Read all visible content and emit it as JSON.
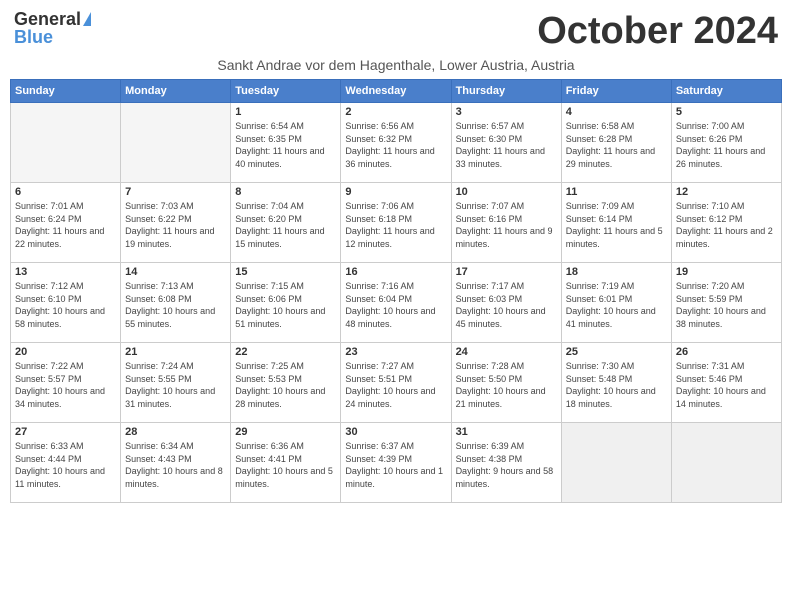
{
  "header": {
    "logo_general": "General",
    "logo_blue": "Blue",
    "month_year": "October 2024",
    "subtitle": "Sankt Andrae vor dem Hagenthale, Lower Austria, Austria"
  },
  "weekdays": [
    "Sunday",
    "Monday",
    "Tuesday",
    "Wednesday",
    "Thursday",
    "Friday",
    "Saturday"
  ],
  "weeks": [
    [
      {
        "day": "",
        "info": ""
      },
      {
        "day": "",
        "info": ""
      },
      {
        "day": "1",
        "info": "Sunrise: 6:54 AM\nSunset: 6:35 PM\nDaylight: 11 hours and 40 minutes."
      },
      {
        "day": "2",
        "info": "Sunrise: 6:56 AM\nSunset: 6:32 PM\nDaylight: 11 hours and 36 minutes."
      },
      {
        "day": "3",
        "info": "Sunrise: 6:57 AM\nSunset: 6:30 PM\nDaylight: 11 hours and 33 minutes."
      },
      {
        "day": "4",
        "info": "Sunrise: 6:58 AM\nSunset: 6:28 PM\nDaylight: 11 hours and 29 minutes."
      },
      {
        "day": "5",
        "info": "Sunrise: 7:00 AM\nSunset: 6:26 PM\nDaylight: 11 hours and 26 minutes."
      }
    ],
    [
      {
        "day": "6",
        "info": "Sunrise: 7:01 AM\nSunset: 6:24 PM\nDaylight: 11 hours and 22 minutes."
      },
      {
        "day": "7",
        "info": "Sunrise: 7:03 AM\nSunset: 6:22 PM\nDaylight: 11 hours and 19 minutes."
      },
      {
        "day": "8",
        "info": "Sunrise: 7:04 AM\nSunset: 6:20 PM\nDaylight: 11 hours and 15 minutes."
      },
      {
        "day": "9",
        "info": "Sunrise: 7:06 AM\nSunset: 6:18 PM\nDaylight: 11 hours and 12 minutes."
      },
      {
        "day": "10",
        "info": "Sunrise: 7:07 AM\nSunset: 6:16 PM\nDaylight: 11 hours and 9 minutes."
      },
      {
        "day": "11",
        "info": "Sunrise: 7:09 AM\nSunset: 6:14 PM\nDaylight: 11 hours and 5 minutes."
      },
      {
        "day": "12",
        "info": "Sunrise: 7:10 AM\nSunset: 6:12 PM\nDaylight: 11 hours and 2 minutes."
      }
    ],
    [
      {
        "day": "13",
        "info": "Sunrise: 7:12 AM\nSunset: 6:10 PM\nDaylight: 10 hours and 58 minutes."
      },
      {
        "day": "14",
        "info": "Sunrise: 7:13 AM\nSunset: 6:08 PM\nDaylight: 10 hours and 55 minutes."
      },
      {
        "day": "15",
        "info": "Sunrise: 7:15 AM\nSunset: 6:06 PM\nDaylight: 10 hours and 51 minutes."
      },
      {
        "day": "16",
        "info": "Sunrise: 7:16 AM\nSunset: 6:04 PM\nDaylight: 10 hours and 48 minutes."
      },
      {
        "day": "17",
        "info": "Sunrise: 7:17 AM\nSunset: 6:03 PM\nDaylight: 10 hours and 45 minutes."
      },
      {
        "day": "18",
        "info": "Sunrise: 7:19 AM\nSunset: 6:01 PM\nDaylight: 10 hours and 41 minutes."
      },
      {
        "day": "19",
        "info": "Sunrise: 7:20 AM\nSunset: 5:59 PM\nDaylight: 10 hours and 38 minutes."
      }
    ],
    [
      {
        "day": "20",
        "info": "Sunrise: 7:22 AM\nSunset: 5:57 PM\nDaylight: 10 hours and 34 minutes."
      },
      {
        "day": "21",
        "info": "Sunrise: 7:24 AM\nSunset: 5:55 PM\nDaylight: 10 hours and 31 minutes."
      },
      {
        "day": "22",
        "info": "Sunrise: 7:25 AM\nSunset: 5:53 PM\nDaylight: 10 hours and 28 minutes."
      },
      {
        "day": "23",
        "info": "Sunrise: 7:27 AM\nSunset: 5:51 PM\nDaylight: 10 hours and 24 minutes."
      },
      {
        "day": "24",
        "info": "Sunrise: 7:28 AM\nSunset: 5:50 PM\nDaylight: 10 hours and 21 minutes."
      },
      {
        "day": "25",
        "info": "Sunrise: 7:30 AM\nSunset: 5:48 PM\nDaylight: 10 hours and 18 minutes."
      },
      {
        "day": "26",
        "info": "Sunrise: 7:31 AM\nSunset: 5:46 PM\nDaylight: 10 hours and 14 minutes."
      }
    ],
    [
      {
        "day": "27",
        "info": "Sunrise: 6:33 AM\nSunset: 4:44 PM\nDaylight: 10 hours and 11 minutes."
      },
      {
        "day": "28",
        "info": "Sunrise: 6:34 AM\nSunset: 4:43 PM\nDaylight: 10 hours and 8 minutes."
      },
      {
        "day": "29",
        "info": "Sunrise: 6:36 AM\nSunset: 4:41 PM\nDaylight: 10 hours and 5 minutes."
      },
      {
        "day": "30",
        "info": "Sunrise: 6:37 AM\nSunset: 4:39 PM\nDaylight: 10 hours and 1 minute."
      },
      {
        "day": "31",
        "info": "Sunrise: 6:39 AM\nSunset: 4:38 PM\nDaylight: 9 hours and 58 minutes."
      },
      {
        "day": "",
        "info": ""
      },
      {
        "day": "",
        "info": ""
      }
    ]
  ]
}
